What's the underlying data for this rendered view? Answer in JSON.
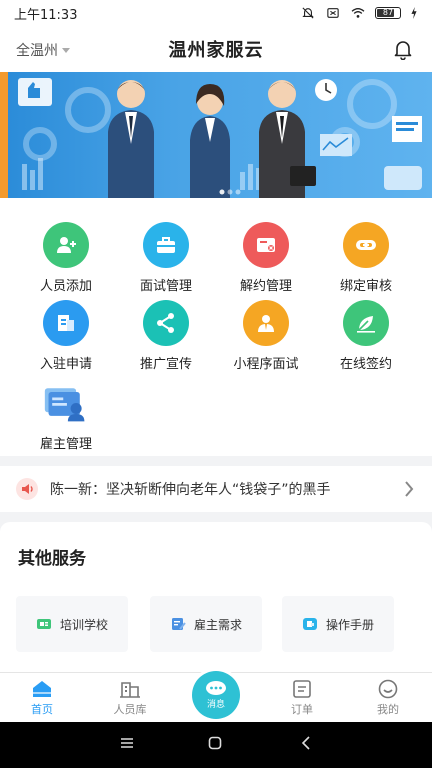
{
  "status_bar": {
    "time": "上午11:33",
    "battery": "87"
  },
  "header": {
    "region": "全温州",
    "title": "温州家服云"
  },
  "menu": {
    "items": [
      {
        "label": "人员添加",
        "icon": "person-add-icon",
        "color": "#3ec57a"
      },
      {
        "label": "面试管理",
        "icon": "briefcase-icon",
        "color": "#2ab3ea"
      },
      {
        "label": "解约管理",
        "icon": "contract-cancel-icon",
        "color": "#ee5a5a"
      },
      {
        "label": "绑定审核",
        "icon": "link-icon",
        "color": "#f5a623"
      },
      {
        "label": "入驻申请",
        "icon": "document-icon",
        "color": "#2b9bf0"
      },
      {
        "label": "推广宣传",
        "icon": "share-icon",
        "color": "#1bc1b5"
      },
      {
        "label": "小程序面试",
        "icon": "interview-icon",
        "color": "#f5a623"
      },
      {
        "label": "在线签约",
        "icon": "pen-leaf-icon",
        "color": "#3ec57a"
      },
      {
        "label": "雇主管理",
        "icon": "employer-icon",
        "color": "#4a90e2"
      }
    ]
  },
  "notice": {
    "text": "陈一新：坚决斩断伸向老年人“钱袋子”的黑手"
  },
  "services": {
    "title": "其他服务",
    "items": [
      {
        "label": "培训学校",
        "icon": "school-icon",
        "color": "#3ec57a"
      },
      {
        "label": "雇主需求",
        "icon": "edit-note-icon",
        "color": "#4a90e2"
      },
      {
        "label": "操作手册",
        "icon": "manual-icon",
        "color": "#2ab3ea"
      }
    ]
  },
  "tabbar": {
    "tabs": [
      {
        "label": "首页",
        "icon": "home-icon",
        "active": true
      },
      {
        "label": "人员库",
        "icon": "building-icon",
        "active": false
      },
      {
        "label": "消息",
        "icon": "message-icon",
        "active": false
      },
      {
        "label": "订单",
        "icon": "order-icon",
        "active": false
      },
      {
        "label": "我的",
        "icon": "smiley-icon",
        "active": false
      }
    ]
  },
  "colors": {
    "accent": "#2a9df4",
    "message_button": "#2ec1d4"
  }
}
